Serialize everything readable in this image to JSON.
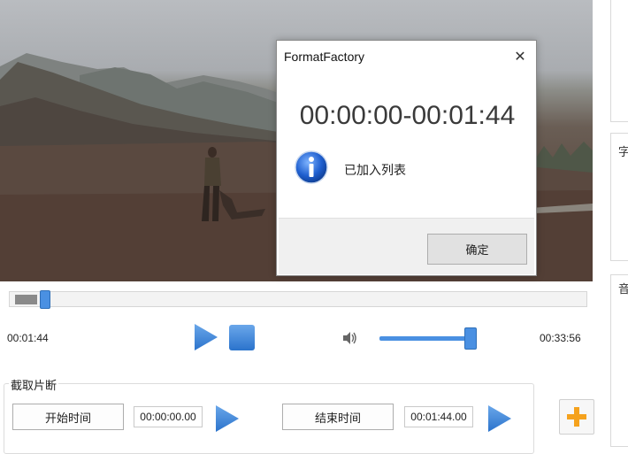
{
  "player": {
    "current_time": "00:01:44",
    "total_time": "00:33:56",
    "seek_position_fraction": 0.05,
    "volume_fraction": 0.9
  },
  "clip": {
    "legend": "截取片断",
    "start_button": "开始时间",
    "start_value": "00:00:00.00",
    "end_button": "结束时间",
    "end_value": "00:01:44.00"
  },
  "dialog": {
    "title": "FormatFactory",
    "time_range": "00:00:00-00:01:44",
    "message": "已加入列表",
    "ok_label": "确定",
    "icon": "info-icon"
  },
  "right_panel": {
    "glyph_1": "字",
    "glyph_2": "音"
  },
  "colors": {
    "accent_blue": "#4a90e2",
    "add_plus": "#f5a21d"
  }
}
